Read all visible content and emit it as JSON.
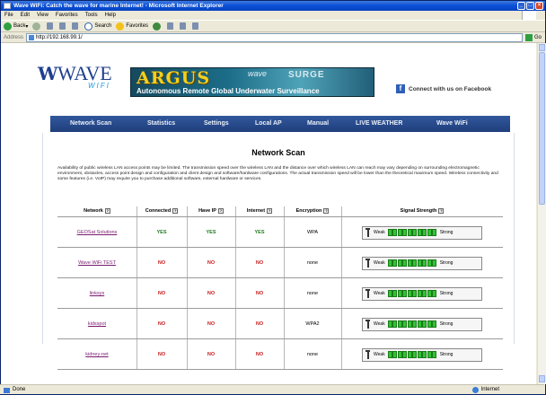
{
  "window": {
    "title": "Wave WiFi: Catch the wave for marine Internet! - Microsoft Internet Explorer"
  },
  "menu": [
    "File",
    "Edit",
    "View",
    "Favorites",
    "Tools",
    "Help"
  ],
  "toolbar": {
    "back_label": "Back",
    "search_label": "Search",
    "favorites_label": "Favorites"
  },
  "address": {
    "label": "Address",
    "url": "http://192.168.99.1/",
    "go_label": "Go"
  },
  "header": {
    "logo_text": "WAVE",
    "logo_sub": "WIFI",
    "banner_title": "ARGUS",
    "banner_wave": "wave",
    "banner_surge": "SURGE",
    "banner_sub": "Autonomous Remote Global Underwater Surveillance",
    "facebook_label": "Connect with us on Facebook"
  },
  "nav": [
    "Network Scan",
    "Statistics",
    "Settings",
    "Local AP",
    "Manual",
    "LIVE WEATHER",
    "Wave WiFi"
  ],
  "page": {
    "title": "Network Scan",
    "description": "Availability of public wireless LAN access points may be limited. The transmission speed over the wireless LAN and the distance over which wireless LAN can reach may vary depending on surrounding electromagnetic environment, obstacles, access point design and configuration and client design and software/hardware configurations. The actual transmission speed will be lower than the theoretical maximum speed. Wireless connectivity and some features (i.e. VoIP) may require you to purchase additional software, external hardware or services."
  },
  "table": {
    "headers": [
      "Network",
      "Connected",
      "Have IP",
      "Internet",
      "Encryption",
      "Signal Strength"
    ],
    "sort_icon": "?",
    "signal_weak_label": "Weak",
    "signal_strong_label": "Strong",
    "rows": [
      {
        "network": "GEOSat Solutions",
        "connected": "YES",
        "have_ip": "YES",
        "internet": "YES",
        "encryption": "WPA"
      },
      {
        "network": "Wave WiFi TEST",
        "connected": "NO",
        "have_ip": "NO",
        "internet": "NO",
        "encryption": "none"
      },
      {
        "network": "linksys",
        "connected": "NO",
        "have_ip": "NO",
        "internet": "NO",
        "encryption": "none"
      },
      {
        "network": "kidsspot",
        "connected": "NO",
        "have_ip": "NO",
        "internet": "NO",
        "encryption": "WPA2"
      },
      {
        "network": "kidney-net",
        "connected": "NO",
        "have_ip": "NO",
        "internet": "NO",
        "encryption": "none"
      }
    ]
  },
  "status": {
    "left": "Done",
    "zone": "Internet"
  }
}
